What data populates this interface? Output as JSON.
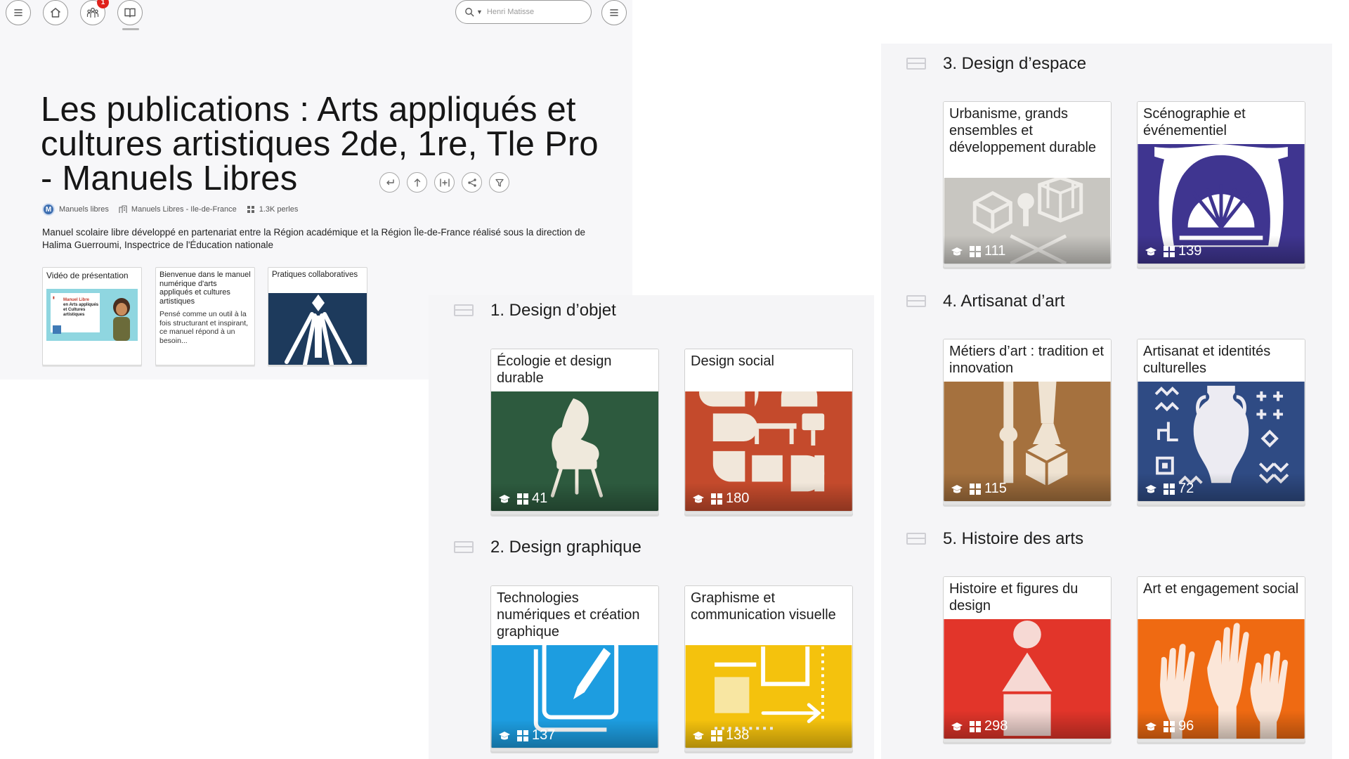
{
  "header": {
    "search_placeholder": "Henri Matisse",
    "notification_count": "1",
    "title": "Les publications : Arts appliqués et cultures artistiques 2de, 1re, Tle Pro - Manuels Libres",
    "meta": {
      "author": "Manuels libres",
      "avatar_letter": "M",
      "collection": "Manuels Libres - Ile-de-France",
      "pearls": "1.3K perles"
    },
    "description": "Manuel scolaire libre développé en partenariat entre la Région académique et la Région Île-de-France réalisé sous la direction de Halima Guerroumi, Inspectrice de l'Éducation nationale",
    "cards": [
      {
        "title": "Vidéo de présentation",
        "thumb_line1": "Manuel Libre",
        "thumb_line2": "en Arts appliqués",
        "thumb_line3": "et Cultures artistiques"
      },
      {
        "title": "Bienvenue dans le manuel numérique d'arts appliqués et cultures artistiques",
        "body": "Pensé comme un outil à la fois structurant et inspirant, ce manuel répond à un besoin..."
      },
      {
        "title": "Pratiques collaboratives"
      }
    ]
  },
  "sections": [
    {
      "title": "1. Design d’objet",
      "cards": [
        {
          "title": "Écologie et design durable",
          "count": "41",
          "color": "#2d5a3e"
        },
        {
          "title": "Design social",
          "count": "180",
          "color": "#c44a2c"
        }
      ]
    },
    {
      "title": "2. Design graphique",
      "cards": [
        {
          "title": "Technologies numériques et création graphique",
          "count": "137",
          "color": "#1d9de0"
        },
        {
          "title": "Graphisme et communication visuelle",
          "count": "138",
          "color": "#f4c20d"
        }
      ]
    },
    {
      "title": "3. Design d’espace",
      "cards": [
        {
          "title": "Urbanisme, grands ensembles et développement durable",
          "count": "111",
          "color": "#c8c6c1"
        },
        {
          "title": "Scénographie et événementiel",
          "count": "139",
          "color": "#3f3590"
        }
      ]
    },
    {
      "title": "4. Artisanat d’art",
      "cards": [
        {
          "title": "Métiers d’art : tradition et innovation",
          "count": "115",
          "color": "#a5713e"
        },
        {
          "title": "Artisanat et identités culturelles",
          "count": "72",
          "color": "#2f4b84"
        }
      ]
    },
    {
      "title": "5. Histoire des arts",
      "cards": [
        {
          "title": "Histoire et figures du design",
          "count": "298",
          "color": "#e2352a"
        },
        {
          "title": "Art et engagement social",
          "count": "96",
          "color": "#ef6a12"
        }
      ]
    }
  ]
}
